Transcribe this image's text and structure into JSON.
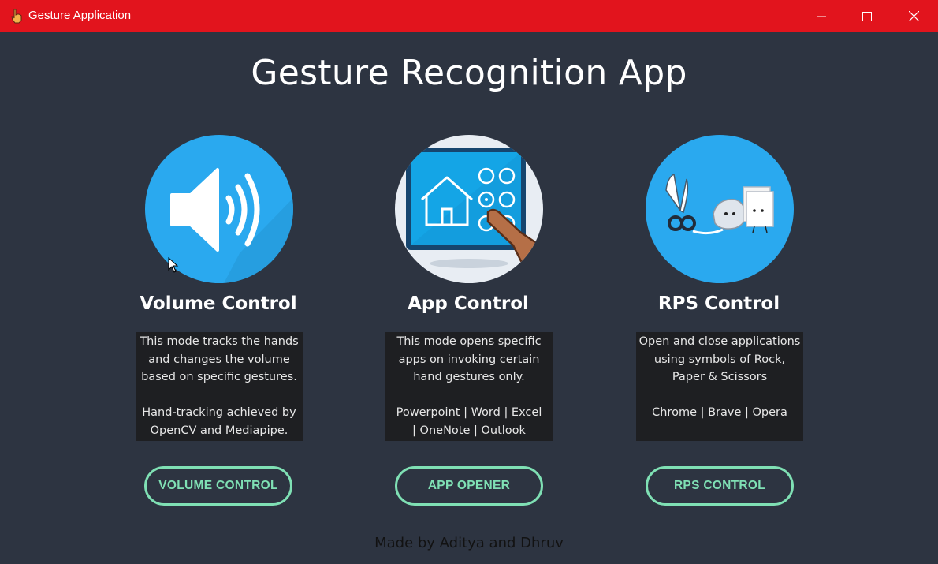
{
  "window": {
    "title": "Gesture Application"
  },
  "heading": "Gesture Recognition App",
  "cards": [
    {
      "title": "Volume Control",
      "icon": "speaker-volume-icon",
      "description_lines": [
        "This mode tracks the hands",
        "and changes the volume",
        "based on specific gestures."
      ],
      "extra_lines": [
        "Hand-tracking achieved by",
        "OpenCV and Mediapipe."
      ],
      "button": "VOLUME CONTROL"
    },
    {
      "title": "App Control",
      "icon": "touch-tablet-icon",
      "description_lines": [
        "This mode opens specific",
        "apps on invoking certain",
        "hand gestures only."
      ],
      "extra_lines": [
        "Powerpoint | Word | Excel",
        "| OneNote | Outlook"
      ],
      "button": "APP OPENER"
    },
    {
      "title": "RPS Control",
      "icon": "rock-paper-scissors-icon",
      "description_lines": [
        "Open and close applications",
        "using symbols of  Rock,",
        "Paper & Scissors"
      ],
      "extra_lines": [
        "Chrome | Brave | Opera"
      ],
      "button": "RPS CONTROL"
    }
  ],
  "footer": "Made by Aditya and Dhruv",
  "colors": {
    "titlebar": "#e2141d",
    "background": "#2d3441",
    "button_accent": "#7fe0b4",
    "description_bg": "#1e1f22",
    "circle_blue": "#2aa9ef"
  }
}
